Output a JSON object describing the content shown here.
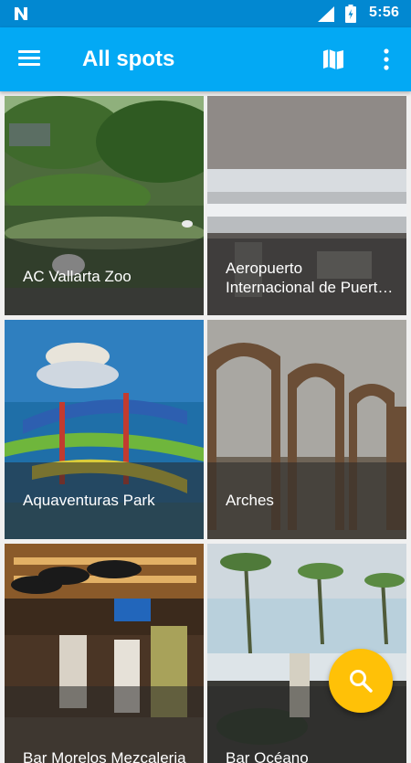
{
  "status_bar": {
    "time": "5:56"
  },
  "app_bar": {
    "title": "All spots"
  },
  "spots": [
    {
      "name": "AC Vallarta Zoo"
    },
    {
      "name": "Aeropuerto Internacional de Puert…"
    },
    {
      "name": "Aquaventuras Park"
    },
    {
      "name": "Arches"
    },
    {
      "name": "Bar Morelos Mezcaleria"
    },
    {
      "name": "Bar Océano"
    }
  ],
  "colors": {
    "status_bar": "#0288d1",
    "app_bar": "#03a9f4",
    "fab": "#ffc107"
  },
  "icons": {
    "status": [
      "notification-n-icon",
      "signal-icon",
      "battery-icon"
    ],
    "app_bar": [
      "menu-icon",
      "map-icon",
      "more-vert-icon"
    ],
    "fab": "search-icon"
  }
}
